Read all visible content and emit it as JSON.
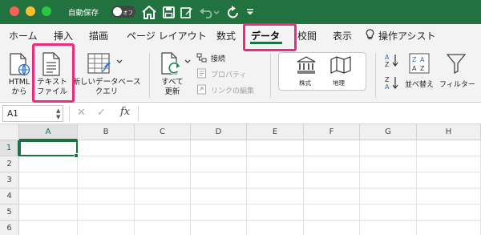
{
  "titlebar": {
    "autosave_label": "自動保存",
    "autosave_state": "オフ"
  },
  "tabs": [
    {
      "label": "ホーム"
    },
    {
      "label": "挿入"
    },
    {
      "label": "描画"
    },
    {
      "label": "ページ レイアウト"
    },
    {
      "label": "数式"
    },
    {
      "label": "データ",
      "active": true
    },
    {
      "label": "校閲"
    },
    {
      "label": "表示"
    },
    {
      "label": "操作アシスト"
    }
  ],
  "ribbon": {
    "html_from": {
      "line1": "HTML",
      "line2": "から"
    },
    "text_file": {
      "line1": "テキスト",
      "line2": "ファイル"
    },
    "new_db_query": {
      "line1": "新しいデータベース",
      "line2": "クエリ"
    },
    "refresh_all": {
      "line1": "すべて",
      "line2": "更新"
    },
    "connections": "接続",
    "properties": "プロパティ",
    "edit_links": "リンクの編集",
    "stocks": "株式",
    "geography": "地理",
    "sort": "並べ替え",
    "filter": "フィルター"
  },
  "formula_bar": {
    "name_box": "A1",
    "cancel_symbol": "✕",
    "enter_symbol": "✓",
    "fx_label": "fx"
  },
  "grid": {
    "columns": [
      "A",
      "B",
      "C",
      "D",
      "E",
      "F",
      "G",
      "H"
    ],
    "rows": [
      "1",
      "2",
      "3",
      "4",
      "5",
      "6"
    ],
    "selected_cell": "A1"
  },
  "colors": {
    "titlebar": "#21723f",
    "accent": "#1e7145",
    "highlight": "#ee2a7b"
  }
}
